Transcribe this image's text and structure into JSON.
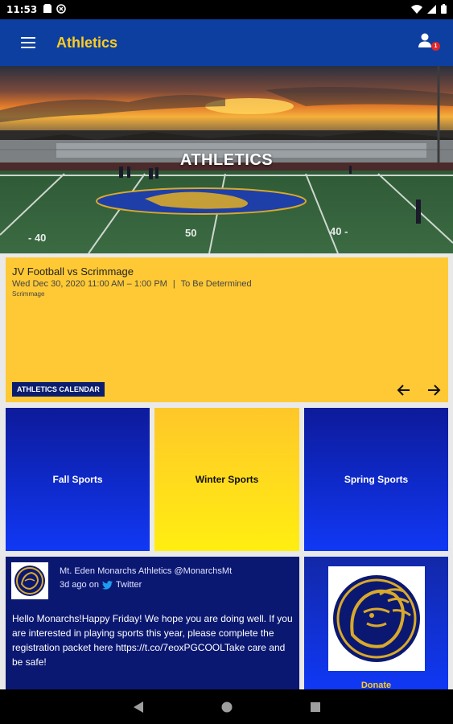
{
  "status_bar": {
    "time": "11:53"
  },
  "app_bar": {
    "title": "Athletics",
    "notification_count": "1"
  },
  "hero": {
    "title": "ATHLETICS"
  },
  "event": {
    "title": "JV Football vs Scrimmage",
    "datetime": "Wed Dec 30, 2020 11:00 AM – 1:00 PM",
    "separator": "|",
    "location": "To Be Determined",
    "type": "Scrimmage",
    "calendar_label": "ATHLETICS CALENDAR"
  },
  "tiles": [
    {
      "label": "Fall Sports"
    },
    {
      "label": "Winter Sports"
    },
    {
      "label": "Spring Sports"
    }
  ],
  "tweet": {
    "author": "Mt. Eden Monarchs Athletics @MonarchsMt",
    "time": "3d ago on",
    "source": "Twitter",
    "text": "Hello Monarchs!Happy Friday! We hope you are doing well. If you are interested in playing sports this year, please complete the registration packet here https://t.co/7eoxPGCOOLTake care and be safe!"
  },
  "donate": {
    "label": "Donate"
  },
  "colors": {
    "brand_blue": "#0d3fa0",
    "brand_gold": "#ffcc1f",
    "event_card": "#ffc935",
    "tweet_card": "#0b1872"
  }
}
